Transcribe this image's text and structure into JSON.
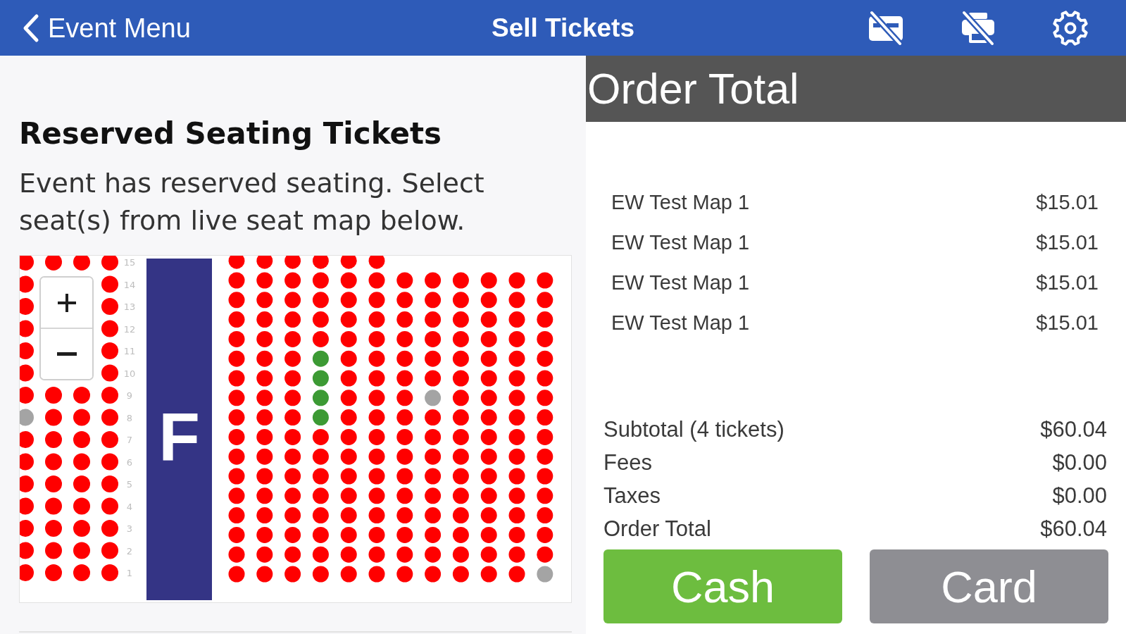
{
  "header": {
    "back_label": "Event Menu",
    "title": "Sell Tickets"
  },
  "reserved_seating": {
    "heading": "Reserved Seating Tickets",
    "description": "Event has reserved seating. Select seat(s) from live seat map below."
  },
  "seat_map": {
    "section_label": "F",
    "left_block": {
      "row_labels": [
        "15",
        "14",
        "13",
        "12",
        "11",
        "10",
        "9",
        "8",
        "7",
        "6",
        "5",
        "4",
        "3",
        "2",
        "1"
      ],
      "columns": [
        {
          "seats": [
            {
              "selected": false,
              "sold": false
            },
            {
              "selected": false,
              "sold": false
            },
            {
              "selected": false,
              "sold": false
            },
            {
              "selected": false,
              "sold": false
            },
            {
              "selected": false,
              "sold": false
            },
            {
              "selected": false,
              "sold": false
            },
            {
              "selected": false,
              "sold": false
            },
            {
              "selected": false,
              "sold": true
            },
            {
              "selected": false,
              "sold": false
            },
            {
              "selected": false,
              "sold": false
            },
            {
              "selected": false,
              "sold": false
            },
            {
              "selected": false,
              "sold": false
            },
            {
              "selected": false,
              "sold": false
            },
            {
              "selected": false,
              "sold": false
            },
            {
              "selected": false,
              "sold": false
            }
          ]
        },
        {
          "top_seats": [
            {
              "selected": false,
              "sold": false
            }
          ],
          "seats": [
            {
              "selected": false,
              "sold": false
            },
            {
              "selected": false,
              "sold": false
            },
            {
              "selected": false,
              "sold": false
            },
            {
              "selected": false,
              "sold": false
            },
            {
              "selected": false,
              "sold": false
            },
            {
              "selected": false,
              "sold": false
            },
            {
              "selected": false,
              "sold": false
            },
            {
              "selected": false,
              "sold": false
            },
            {
              "selected": false,
              "sold": false
            }
          ]
        },
        {
          "top_seats": [
            {
              "selected": false,
              "sold": false
            }
          ],
          "seats": [
            {
              "selected": false,
              "sold": false
            },
            {
              "selected": false,
              "sold": false
            },
            {
              "selected": false,
              "sold": false
            },
            {
              "selected": false,
              "sold": false
            },
            {
              "selected": false,
              "sold": false
            },
            {
              "selected": false,
              "sold": false
            },
            {
              "selected": false,
              "sold": false
            },
            {
              "selected": false,
              "sold": false
            },
            {
              "selected": false,
              "sold": false
            }
          ]
        },
        {
          "seats": [
            {
              "selected": false,
              "sold": false
            },
            {
              "selected": false,
              "sold": false
            },
            {
              "selected": false,
              "sold": false
            },
            {
              "selected": false,
              "sold": false
            },
            {
              "selected": false,
              "sold": false
            },
            {
              "selected": false,
              "sold": false
            },
            {
              "selected": false,
              "sold": false
            },
            {
              "selected": false,
              "sold": false
            },
            {
              "selected": false,
              "sold": false
            },
            {
              "selected": false,
              "sold": false
            },
            {
              "selected": false,
              "sold": false
            },
            {
              "selected": false,
              "sold": false
            },
            {
              "selected": false,
              "sold": false
            },
            {
              "selected": false,
              "sold": false
            },
            {
              "selected": false,
              "sold": false
            }
          ]
        }
      ]
    },
    "right_block": {
      "columns": [
        {
          "seats": [
            {
              "selected": false,
              "sold": false
            },
            {
              "selected": false,
              "sold": false
            },
            {
              "selected": false,
              "sold": false
            },
            {
              "selected": false,
              "sold": false
            },
            {
              "selected": false,
              "sold": false
            },
            {
              "selected": false,
              "sold": false
            },
            {
              "selected": false,
              "sold": false
            },
            {
              "selected": false,
              "sold": false
            },
            {
              "selected": false,
              "sold": false
            },
            {
              "selected": false,
              "sold": false
            },
            {
              "selected": false,
              "sold": false
            },
            {
              "selected": false,
              "sold": false
            },
            {
              "selected": false,
              "sold": false
            },
            {
              "selected": false,
              "sold": false
            },
            {
              "selected": false,
              "sold": false
            },
            {
              "selected": false,
              "sold": false
            },
            {
              "selected": false,
              "sold": false
            }
          ]
        },
        {
          "seats": [
            {
              "selected": false,
              "sold": false
            },
            {
              "selected": false,
              "sold": false
            },
            {
              "selected": false,
              "sold": false
            },
            {
              "selected": false,
              "sold": false
            },
            {
              "selected": false,
              "sold": false
            },
            {
              "selected": false,
              "sold": false
            },
            {
              "selected": false,
              "sold": false
            },
            {
              "selected": false,
              "sold": false
            },
            {
              "selected": false,
              "sold": false
            },
            {
              "selected": false,
              "sold": false
            },
            {
              "selected": false,
              "sold": false
            },
            {
              "selected": false,
              "sold": false
            },
            {
              "selected": false,
              "sold": false
            },
            {
              "selected": false,
              "sold": false
            },
            {
              "selected": false,
              "sold": false
            },
            {
              "selected": false,
              "sold": false
            },
            {
              "selected": false,
              "sold": false
            }
          ]
        },
        {
          "seats": [
            {
              "selected": false,
              "sold": false
            },
            {
              "selected": false,
              "sold": false
            },
            {
              "selected": false,
              "sold": false
            },
            {
              "selected": false,
              "sold": false
            },
            {
              "selected": false,
              "sold": false
            },
            {
              "selected": false,
              "sold": false
            },
            {
              "selected": false,
              "sold": false
            },
            {
              "selected": false,
              "sold": false
            },
            {
              "selected": false,
              "sold": false
            },
            {
              "selected": false,
              "sold": false
            },
            {
              "selected": false,
              "sold": false
            },
            {
              "selected": false,
              "sold": false
            },
            {
              "selected": false,
              "sold": false
            },
            {
              "selected": false,
              "sold": false
            },
            {
              "selected": false,
              "sold": false
            },
            {
              "selected": false,
              "sold": false
            },
            {
              "selected": false,
              "sold": false
            }
          ]
        },
        {
          "seats": [
            {
              "selected": false,
              "sold": false
            },
            {
              "selected": false,
              "sold": false
            },
            {
              "selected": false,
              "sold": false
            },
            {
              "selected": false,
              "sold": false
            },
            {
              "selected": false,
              "sold": false
            },
            {
              "selected": true,
              "sold": false
            },
            {
              "selected": true,
              "sold": false
            },
            {
              "selected": true,
              "sold": false
            },
            {
              "selected": true,
              "sold": false
            },
            {
              "selected": false,
              "sold": false
            },
            {
              "selected": false,
              "sold": false
            },
            {
              "selected": false,
              "sold": false
            },
            {
              "selected": false,
              "sold": false
            },
            {
              "selected": false,
              "sold": false
            },
            {
              "selected": false,
              "sold": false
            },
            {
              "selected": false,
              "sold": false
            },
            {
              "selected": false,
              "sold": false
            }
          ]
        },
        {
          "seats": [
            {
              "selected": false,
              "sold": false
            },
            {
              "selected": false,
              "sold": false
            },
            {
              "selected": false,
              "sold": false
            },
            {
              "selected": false,
              "sold": false
            },
            {
              "selected": false,
              "sold": false
            },
            {
              "selected": false,
              "sold": false
            },
            {
              "selected": false,
              "sold": false
            },
            {
              "selected": false,
              "sold": false
            },
            {
              "selected": false,
              "sold": false
            },
            {
              "selected": false,
              "sold": false
            },
            {
              "selected": false,
              "sold": false
            },
            {
              "selected": false,
              "sold": false
            },
            {
              "selected": false,
              "sold": false
            },
            {
              "selected": false,
              "sold": false
            },
            {
              "selected": false,
              "sold": false
            },
            {
              "selected": false,
              "sold": false
            },
            {
              "selected": false,
              "sold": false
            }
          ]
        },
        {
          "seats": [
            {
              "selected": false,
              "sold": false
            },
            {
              "selected": false,
              "sold": false
            },
            {
              "selected": false,
              "sold": false
            },
            {
              "selected": false,
              "sold": false
            },
            {
              "selected": false,
              "sold": false
            },
            {
              "selected": false,
              "sold": false
            },
            {
              "selected": false,
              "sold": false
            },
            {
              "selected": false,
              "sold": false
            },
            {
              "selected": false,
              "sold": false
            },
            {
              "selected": false,
              "sold": false
            },
            {
              "selected": false,
              "sold": false
            },
            {
              "selected": false,
              "sold": false
            },
            {
              "selected": false,
              "sold": false
            },
            {
              "selected": false,
              "sold": false
            },
            {
              "selected": false,
              "sold": false
            },
            {
              "selected": false,
              "sold": false
            },
            {
              "selected": false,
              "sold": false
            }
          ]
        },
        {
          "seats": [
            {
              "selected": false,
              "sold": false
            },
            {
              "selected": false,
              "sold": false
            },
            {
              "selected": false,
              "sold": false
            },
            {
              "selected": false,
              "sold": false
            },
            {
              "selected": false,
              "sold": false
            },
            {
              "selected": false,
              "sold": false
            },
            {
              "selected": false,
              "sold": false
            },
            {
              "selected": false,
              "sold": false
            },
            {
              "selected": false,
              "sold": false
            },
            {
              "selected": false,
              "sold": false
            },
            {
              "selected": false,
              "sold": false
            },
            {
              "selected": false,
              "sold": false
            },
            {
              "selected": false,
              "sold": false
            },
            {
              "selected": false,
              "sold": false
            },
            {
              "selected": false,
              "sold": false
            },
            {
              "selected": false,
              "sold": false
            }
          ]
        },
        {
          "seats": [
            {
              "selected": false,
              "sold": false
            },
            {
              "selected": false,
              "sold": false
            },
            {
              "selected": false,
              "sold": false
            },
            {
              "selected": false,
              "sold": false
            },
            {
              "selected": false,
              "sold": false
            },
            {
              "selected": false,
              "sold": false
            },
            {
              "selected": false,
              "sold": true
            },
            {
              "selected": false,
              "sold": false
            },
            {
              "selected": false,
              "sold": false
            },
            {
              "selected": false,
              "sold": false
            },
            {
              "selected": false,
              "sold": false
            },
            {
              "selected": false,
              "sold": false
            },
            {
              "selected": false,
              "sold": false
            },
            {
              "selected": false,
              "sold": false
            },
            {
              "selected": false,
              "sold": false
            },
            {
              "selected": false,
              "sold": false
            }
          ]
        },
        {
          "seats": [
            {
              "selected": false,
              "sold": false
            },
            {
              "selected": false,
              "sold": false
            },
            {
              "selected": false,
              "sold": false
            },
            {
              "selected": false,
              "sold": false
            },
            {
              "selected": false,
              "sold": false
            },
            {
              "selected": false,
              "sold": false
            },
            {
              "selected": false,
              "sold": false
            },
            {
              "selected": false,
              "sold": false
            },
            {
              "selected": false,
              "sold": false
            },
            {
              "selected": false,
              "sold": false
            },
            {
              "selected": false,
              "sold": false
            },
            {
              "selected": false,
              "sold": false
            },
            {
              "selected": false,
              "sold": false
            },
            {
              "selected": false,
              "sold": false
            },
            {
              "selected": false,
              "sold": false
            },
            {
              "selected": false,
              "sold": false
            }
          ]
        },
        {
          "seats": [
            {
              "selected": false,
              "sold": false
            },
            {
              "selected": false,
              "sold": false
            },
            {
              "selected": false,
              "sold": false
            },
            {
              "selected": false,
              "sold": false
            },
            {
              "selected": false,
              "sold": false
            },
            {
              "selected": false,
              "sold": false
            },
            {
              "selected": false,
              "sold": false
            },
            {
              "selected": false,
              "sold": false
            },
            {
              "selected": false,
              "sold": false
            },
            {
              "selected": false,
              "sold": false
            },
            {
              "selected": false,
              "sold": false
            },
            {
              "selected": false,
              "sold": false
            },
            {
              "selected": false,
              "sold": false
            },
            {
              "selected": false,
              "sold": false
            },
            {
              "selected": false,
              "sold": false
            },
            {
              "selected": false,
              "sold": false
            }
          ]
        },
        {
          "seats": [
            {
              "selected": false,
              "sold": false
            },
            {
              "selected": false,
              "sold": false
            },
            {
              "selected": false,
              "sold": false
            },
            {
              "selected": false,
              "sold": false
            },
            {
              "selected": false,
              "sold": false
            },
            {
              "selected": false,
              "sold": false
            },
            {
              "selected": false,
              "sold": false
            },
            {
              "selected": false,
              "sold": false
            },
            {
              "selected": false,
              "sold": false
            },
            {
              "selected": false,
              "sold": false
            },
            {
              "selected": false,
              "sold": false
            },
            {
              "selected": false,
              "sold": false
            },
            {
              "selected": false,
              "sold": false
            },
            {
              "selected": false,
              "sold": false
            },
            {
              "selected": false,
              "sold": false
            },
            {
              "selected": false,
              "sold": false
            }
          ]
        },
        {
          "seats": [
            {
              "selected": false,
              "sold": false
            },
            {
              "selected": false,
              "sold": false
            },
            {
              "selected": false,
              "sold": false
            },
            {
              "selected": false,
              "sold": false
            },
            {
              "selected": false,
              "sold": false
            },
            {
              "selected": false,
              "sold": false
            },
            {
              "selected": false,
              "sold": false
            },
            {
              "selected": false,
              "sold": false
            },
            {
              "selected": false,
              "sold": false
            },
            {
              "selected": false,
              "sold": false
            },
            {
              "selected": false,
              "sold": false
            },
            {
              "selected": false,
              "sold": false
            },
            {
              "selected": false,
              "sold": false
            },
            {
              "selected": false,
              "sold": false
            },
            {
              "selected": false,
              "sold": false
            },
            {
              "selected": false,
              "sold": true
            }
          ]
        }
      ]
    }
  },
  "order": {
    "title": "Order Total",
    "items": [
      {
        "name": "EW Test Map 1",
        "price": "$15.01"
      },
      {
        "name": "EW Test Map 1",
        "price": "$15.01"
      },
      {
        "name": "EW Test Map 1",
        "price": "$15.01"
      },
      {
        "name": "EW Test Map 1",
        "price": "$15.01"
      }
    ],
    "summary": [
      {
        "label": "Subtotal (4 tickets)",
        "value": "$60.04"
      },
      {
        "label": "Fees",
        "value": "$0.00"
      },
      {
        "label": "Taxes",
        "value": "$0.00"
      },
      {
        "label": "Order Total",
        "value": "$60.04"
      }
    ],
    "buttons": [
      {
        "label": "Cash",
        "kind": "cash"
      },
      {
        "label": "Card",
        "kind": "card"
      }
    ]
  }
}
